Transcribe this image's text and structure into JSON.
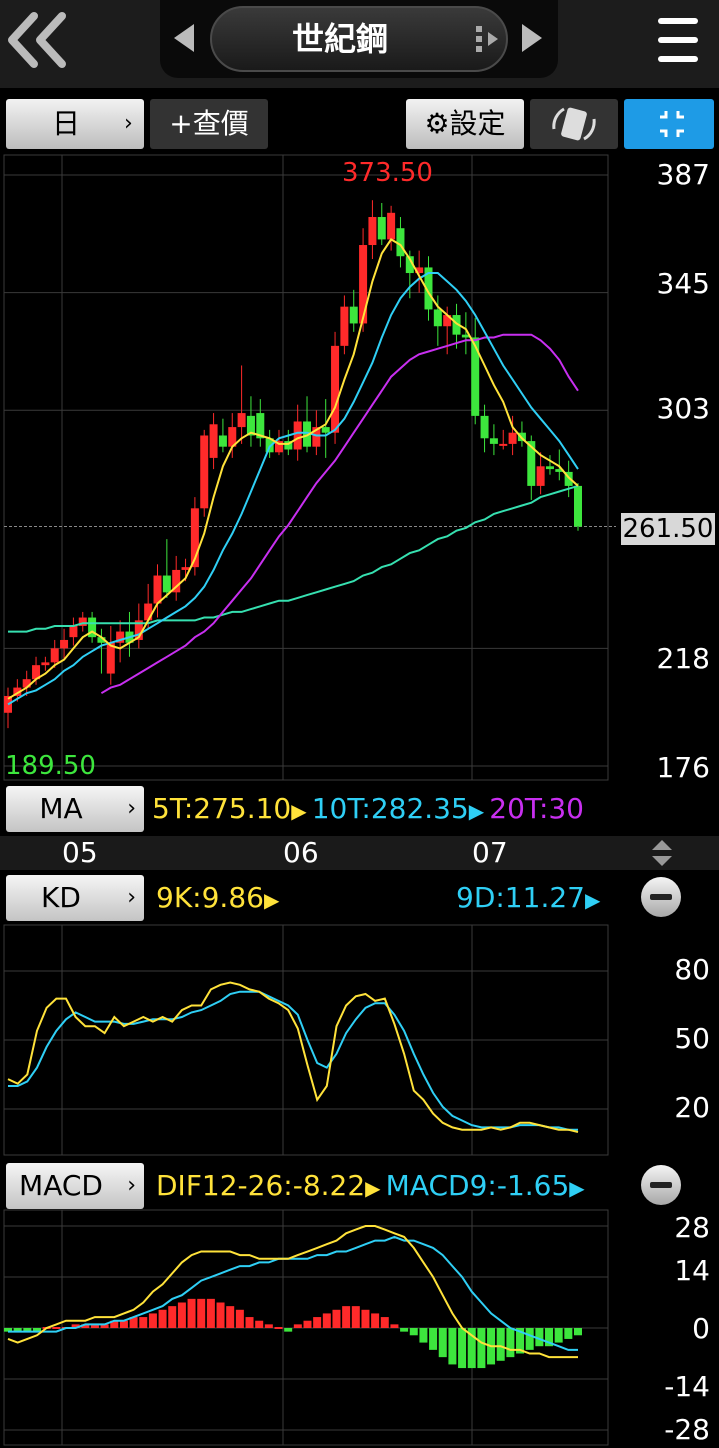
{
  "header": {
    "title": "世紀鋼",
    "back_icon": "double-chevron-left-icon",
    "menu_icon": "hamburger-menu-icon"
  },
  "toolbar": {
    "period": "日",
    "query": "+查價",
    "settings": "⚙設定",
    "rotate_icon": "rotate-device-icon",
    "fullscreen_icon": "fullscreen-exit-icon"
  },
  "colors": {
    "up": "#ff2a2a",
    "down": "#3de63d",
    "ma5": "#ffe23a",
    "ma10": "#2fcff5",
    "ma20": "#c82ff0",
    "ma60": "#36e0b0",
    "grid": "#3a3a3a",
    "accent": "#1e9be6"
  },
  "main_chart": {
    "high_label": "373.50",
    "low_label": "189.50",
    "last_price": "261.50",
    "y_ticks": [
      "387",
      "345",
      "303",
      "218",
      "176"
    ],
    "x_ticks": [
      "05",
      "06",
      "07"
    ]
  },
  "ma_panel": {
    "label": "MA",
    "ma5": "5T:275.10",
    "ma10": "10T:282.35",
    "ma20": "20T:30"
  },
  "kd_panel": {
    "label": "KD",
    "k": "9K:9.86",
    "d": "9D:11.27",
    "y_ticks": [
      "80",
      "50",
      "20"
    ]
  },
  "macd_panel": {
    "label": "MACD",
    "dif": "DIF12-26:-8.22",
    "macd": "MACD9:-1.65",
    "y_ticks": [
      "28",
      "14",
      "0",
      "-14",
      "-28"
    ]
  },
  "chart_data": [
    {
      "type": "candlestick",
      "ylim": [
        176,
        387
      ],
      "high": 373.5,
      "low": 189.5,
      "last": 261.5,
      "candles": [
        [
          195,
          201,
          189.5,
          204
        ],
        [
          201,
          204,
          199,
          207
        ],
        [
          204,
          207,
          201,
          210
        ],
        [
          207,
          212,
          205,
          215
        ],
        [
          212,
          213,
          210,
          215
        ],
        [
          213,
          218,
          211,
          221
        ],
        [
          218,
          221,
          214,
          225
        ],
        [
          222,
          226,
          219,
          229
        ],
        [
          226,
          229,
          224,
          231
        ],
        [
          229,
          222,
          220,
          231
        ],
        [
          222,
          220,
          209,
          225
        ],
        [
          209,
          220,
          205,
          226
        ],
        [
          220,
          224,
          213,
          228
        ],
        [
          224,
          220,
          215,
          231
        ],
        [
          221,
          228,
          218,
          234
        ],
        [
          228,
          234,
          225,
          241
        ],
        [
          234,
          244,
          229,
          248
        ],
        [
          244,
          238,
          236,
          257
        ],
        [
          238,
          246,
          235,
          251
        ],
        [
          246,
          247,
          242,
          250
        ],
        [
          247,
          268,
          244,
          272
        ],
        [
          268,
          294,
          265,
          296
        ],
        [
          286,
          298,
          282,
          302
        ],
        [
          294,
          290,
          288,
          300
        ],
        [
          290,
          297,
          286,
          302
        ],
        [
          297,
          302,
          291,
          319
        ],
        [
          301,
          294,
          290,
          308
        ],
        [
          302,
          293,
          290,
          307
        ],
        [
          293,
          288,
          286,
          296
        ],
        [
          288,
          292,
          287,
          296
        ],
        [
          292,
          289,
          287,
          296
        ],
        [
          289,
          299,
          285,
          305
        ],
        [
          299,
          290,
          288,
          308
        ],
        [
          290,
          297,
          287,
          303
        ],
        [
          297,
          295,
          286,
          307
        ],
        [
          295,
          326,
          291,
          331
        ],
        [
          326,
          340,
          323,
          344
        ],
        [
          340,
          334,
          331,
          346
        ],
        [
          334,
          362,
          331,
          368
        ],
        [
          362,
          372,
          357,
          378
        ],
        [
          372,
          364,
          362,
          377
        ],
        [
          364,
          373.5,
          360,
          376
        ],
        [
          368,
          358,
          354,
          372
        ],
        [
          358,
          352,
          343,
          360
        ],
        [
          352,
          354,
          345,
          360
        ],
        [
          354,
          339,
          335,
          358
        ],
        [
          339,
          333,
          326,
          344
        ],
        [
          333,
          337,
          323,
          340
        ],
        [
          337,
          330,
          325,
          341
        ],
        [
          330,
          329,
          323,
          338
        ],
        [
          329,
          301,
          298,
          336
        ],
        [
          301,
          293,
          288,
          305
        ],
        [
          293,
          291,
          287,
          298
        ],
        [
          291,
          291,
          289,
          296
        ],
        [
          291,
          295,
          287,
          301
        ],
        [
          295,
          292,
          290,
          299
        ],
        [
          292,
          276,
          271,
          294
        ],
        [
          276,
          283,
          273,
          288
        ],
        [
          283,
          282,
          280,
          287
        ],
        [
          282,
          281,
          278,
          289
        ],
        [
          281,
          276,
          272,
          285
        ],
        [
          276,
          261.5,
          260,
          277
        ]
      ],
      "ma5": [
        200,
        202,
        204,
        207,
        209,
        212,
        214,
        218,
        222,
        224,
        222,
        219,
        218,
        220,
        222,
        228,
        234,
        237,
        240,
        243,
        250,
        259,
        272,
        283,
        290,
        293,
        295,
        294,
        293,
        291,
        291,
        293,
        294,
        296,
        298,
        304,
        314,
        323,
        336,
        349,
        359,
        364,
        362,
        357,
        351,
        345,
        340,
        337,
        334,
        332,
        326,
        319,
        312,
        306,
        297,
        293,
        290,
        287,
        285,
        283,
        279,
        276
      ],
      "ma10": [
        198,
        200,
        202,
        203,
        205,
        207,
        210,
        212,
        215,
        217,
        219,
        220,
        221,
        222,
        223,
        225,
        227,
        229,
        231,
        233,
        236,
        240,
        246,
        253,
        259,
        266,
        274,
        282,
        290,
        293,
        294,
        295,
        295,
        294,
        294,
        296,
        300,
        306,
        313,
        320,
        329,
        337,
        343,
        347,
        350,
        352,
        352,
        349,
        346,
        342,
        337,
        331,
        325,
        319,
        314,
        309,
        304,
        300,
        296,
        292,
        287,
        282
      ],
      "ma20": [
        null,
        null,
        null,
        null,
        null,
        null,
        null,
        null,
        null,
        null,
        202,
        204,
        205,
        207,
        209,
        211,
        213,
        215,
        217,
        219,
        222,
        224,
        227,
        231,
        235,
        239,
        243,
        248,
        253,
        258,
        262,
        267,
        272,
        277,
        281,
        285,
        290,
        295,
        300,
        305,
        310,
        315,
        318,
        321,
        323,
        324,
        325,
        326,
        327,
        328,
        328,
        329,
        329,
        330,
        330,
        330,
        330,
        328,
        325,
        321,
        315,
        310
      ],
      "ma60": [
        224,
        224,
        224,
        225,
        225,
        226,
        226,
        226,
        227,
        227,
        227,
        227,
        227,
        227,
        227,
        227,
        228,
        228,
        228,
        228,
        228,
        229,
        229,
        230,
        231,
        231,
        232,
        233,
        234,
        235,
        235,
        236,
        237,
        238,
        239,
        240,
        241,
        242,
        244,
        245,
        247,
        248,
        250,
        252,
        253,
        255,
        257,
        258,
        260,
        261,
        263,
        264,
        266,
        267,
        268,
        269,
        270,
        272,
        273,
        274,
        275,
        276
      ]
    },
    {
      "type": "line",
      "name": "KD",
      "ylim": [
        0,
        100
      ],
      "k": [
        33,
        31,
        35,
        54,
        64,
        68,
        68,
        60,
        56,
        56,
        53,
        60,
        56,
        58,
        60,
        58,
        60,
        58,
        63,
        65,
        65,
        72,
        74,
        75,
        74,
        72,
        71,
        68,
        66,
        63,
        55,
        39,
        24,
        30,
        56,
        65,
        69,
        70,
        67,
        68,
        57,
        44,
        28,
        24,
        18,
        14,
        12,
        11,
        11,
        11,
        12,
        11,
        12,
        14,
        14,
        13,
        12,
        11,
        11,
        10
      ],
      "d": [
        30,
        30,
        32,
        38,
        47,
        54,
        59,
        62,
        60,
        58,
        58,
        58,
        57,
        57,
        58,
        59,
        59,
        59,
        60,
        62,
        63,
        65,
        67,
        70,
        71,
        71,
        71,
        69,
        67,
        65,
        61,
        50,
        40,
        38,
        44,
        53,
        59,
        64,
        66,
        66,
        61,
        54,
        44,
        35,
        27,
        21,
        17,
        15,
        13,
        12,
        12,
        12,
        12,
        13,
        13,
        13,
        12,
        12,
        11,
        11
      ]
    },
    {
      "type": "bar+line",
      "name": "MACD",
      "ylim": [
        -28,
        28
      ],
      "dif": [
        -3,
        -4,
        -3,
        -2,
        0,
        1,
        2,
        2,
        2,
        3,
        3,
        3,
        4,
        5,
        7,
        10,
        12,
        15,
        18,
        20,
        21,
        21,
        21,
        21,
        20,
        20,
        19,
        19,
        19,
        19,
        20,
        21,
        22,
        23,
        24,
        26,
        27,
        28,
        28,
        27,
        26,
        25,
        22,
        18,
        14,
        9,
        4,
        0,
        -2,
        -4,
        -5,
        -5,
        -6,
        -6,
        -7,
        -7,
        -8,
        -8,
        -8,
        -8
      ],
      "macd": [
        -1,
        -1,
        -1,
        -1,
        -1,
        -1,
        0,
        0,
        1,
        1,
        1,
        2,
        2,
        3,
        4,
        5,
        6,
        8,
        9,
        11,
        13,
        14,
        15,
        16,
        17,
        17,
        18,
        18,
        19,
        19,
        19,
        19,
        20,
        20,
        21,
        21,
        22,
        23,
        24,
        24,
        25,
        24,
        24,
        23,
        22,
        20,
        17,
        14,
        10,
        7,
        4,
        2,
        0,
        -1,
        -2,
        -3,
        -4,
        -5,
        -6,
        -6
      ],
      "osc": [
        -1,
        -1,
        -1,
        -1,
        0,
        0,
        0,
        1,
        1,
        1,
        1,
        2,
        2,
        3,
        3,
        4,
        5,
        6,
        7,
        8,
        8,
        8,
        7,
        6,
        5,
        3,
        2,
        1,
        0,
        -1,
        1,
        2,
        3,
        4,
        5,
        6,
        6,
        5,
        4,
        3,
        1,
        -1,
        -2,
        -4,
        -6,
        -8,
        -10,
        -11,
        -11,
        -11,
        -10,
        -9,
        -8,
        -7,
        -6,
        -5,
        -5,
        -4,
        -3,
        -2
      ]
    }
  ]
}
